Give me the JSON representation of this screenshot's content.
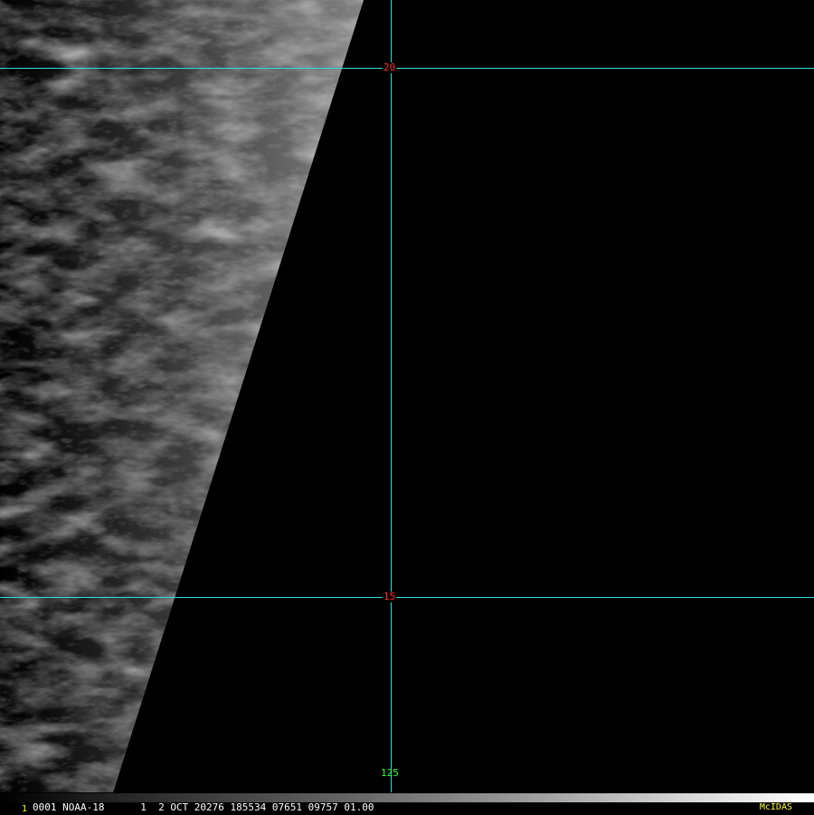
{
  "grid": {
    "lat_lines": [
      {
        "label": "20",
        "color": "#ff3030"
      },
      {
        "label": "15",
        "color": "#ff3030"
      }
    ],
    "lon_lines": [
      {
        "label": "125",
        "color": "#33ff33"
      }
    ],
    "line_color": "#33dddd"
  },
  "status": {
    "frame_number": "1",
    "info": "0001 NOAA-18      1  2 OCT 20276 185534 07651 09757 01.00",
    "brand": "McIDAS",
    "brand_color": "#ffff33"
  },
  "imagery": {
    "satellite": "NOAA-18",
    "style": "grayscale cloud imagery with swath edge"
  }
}
